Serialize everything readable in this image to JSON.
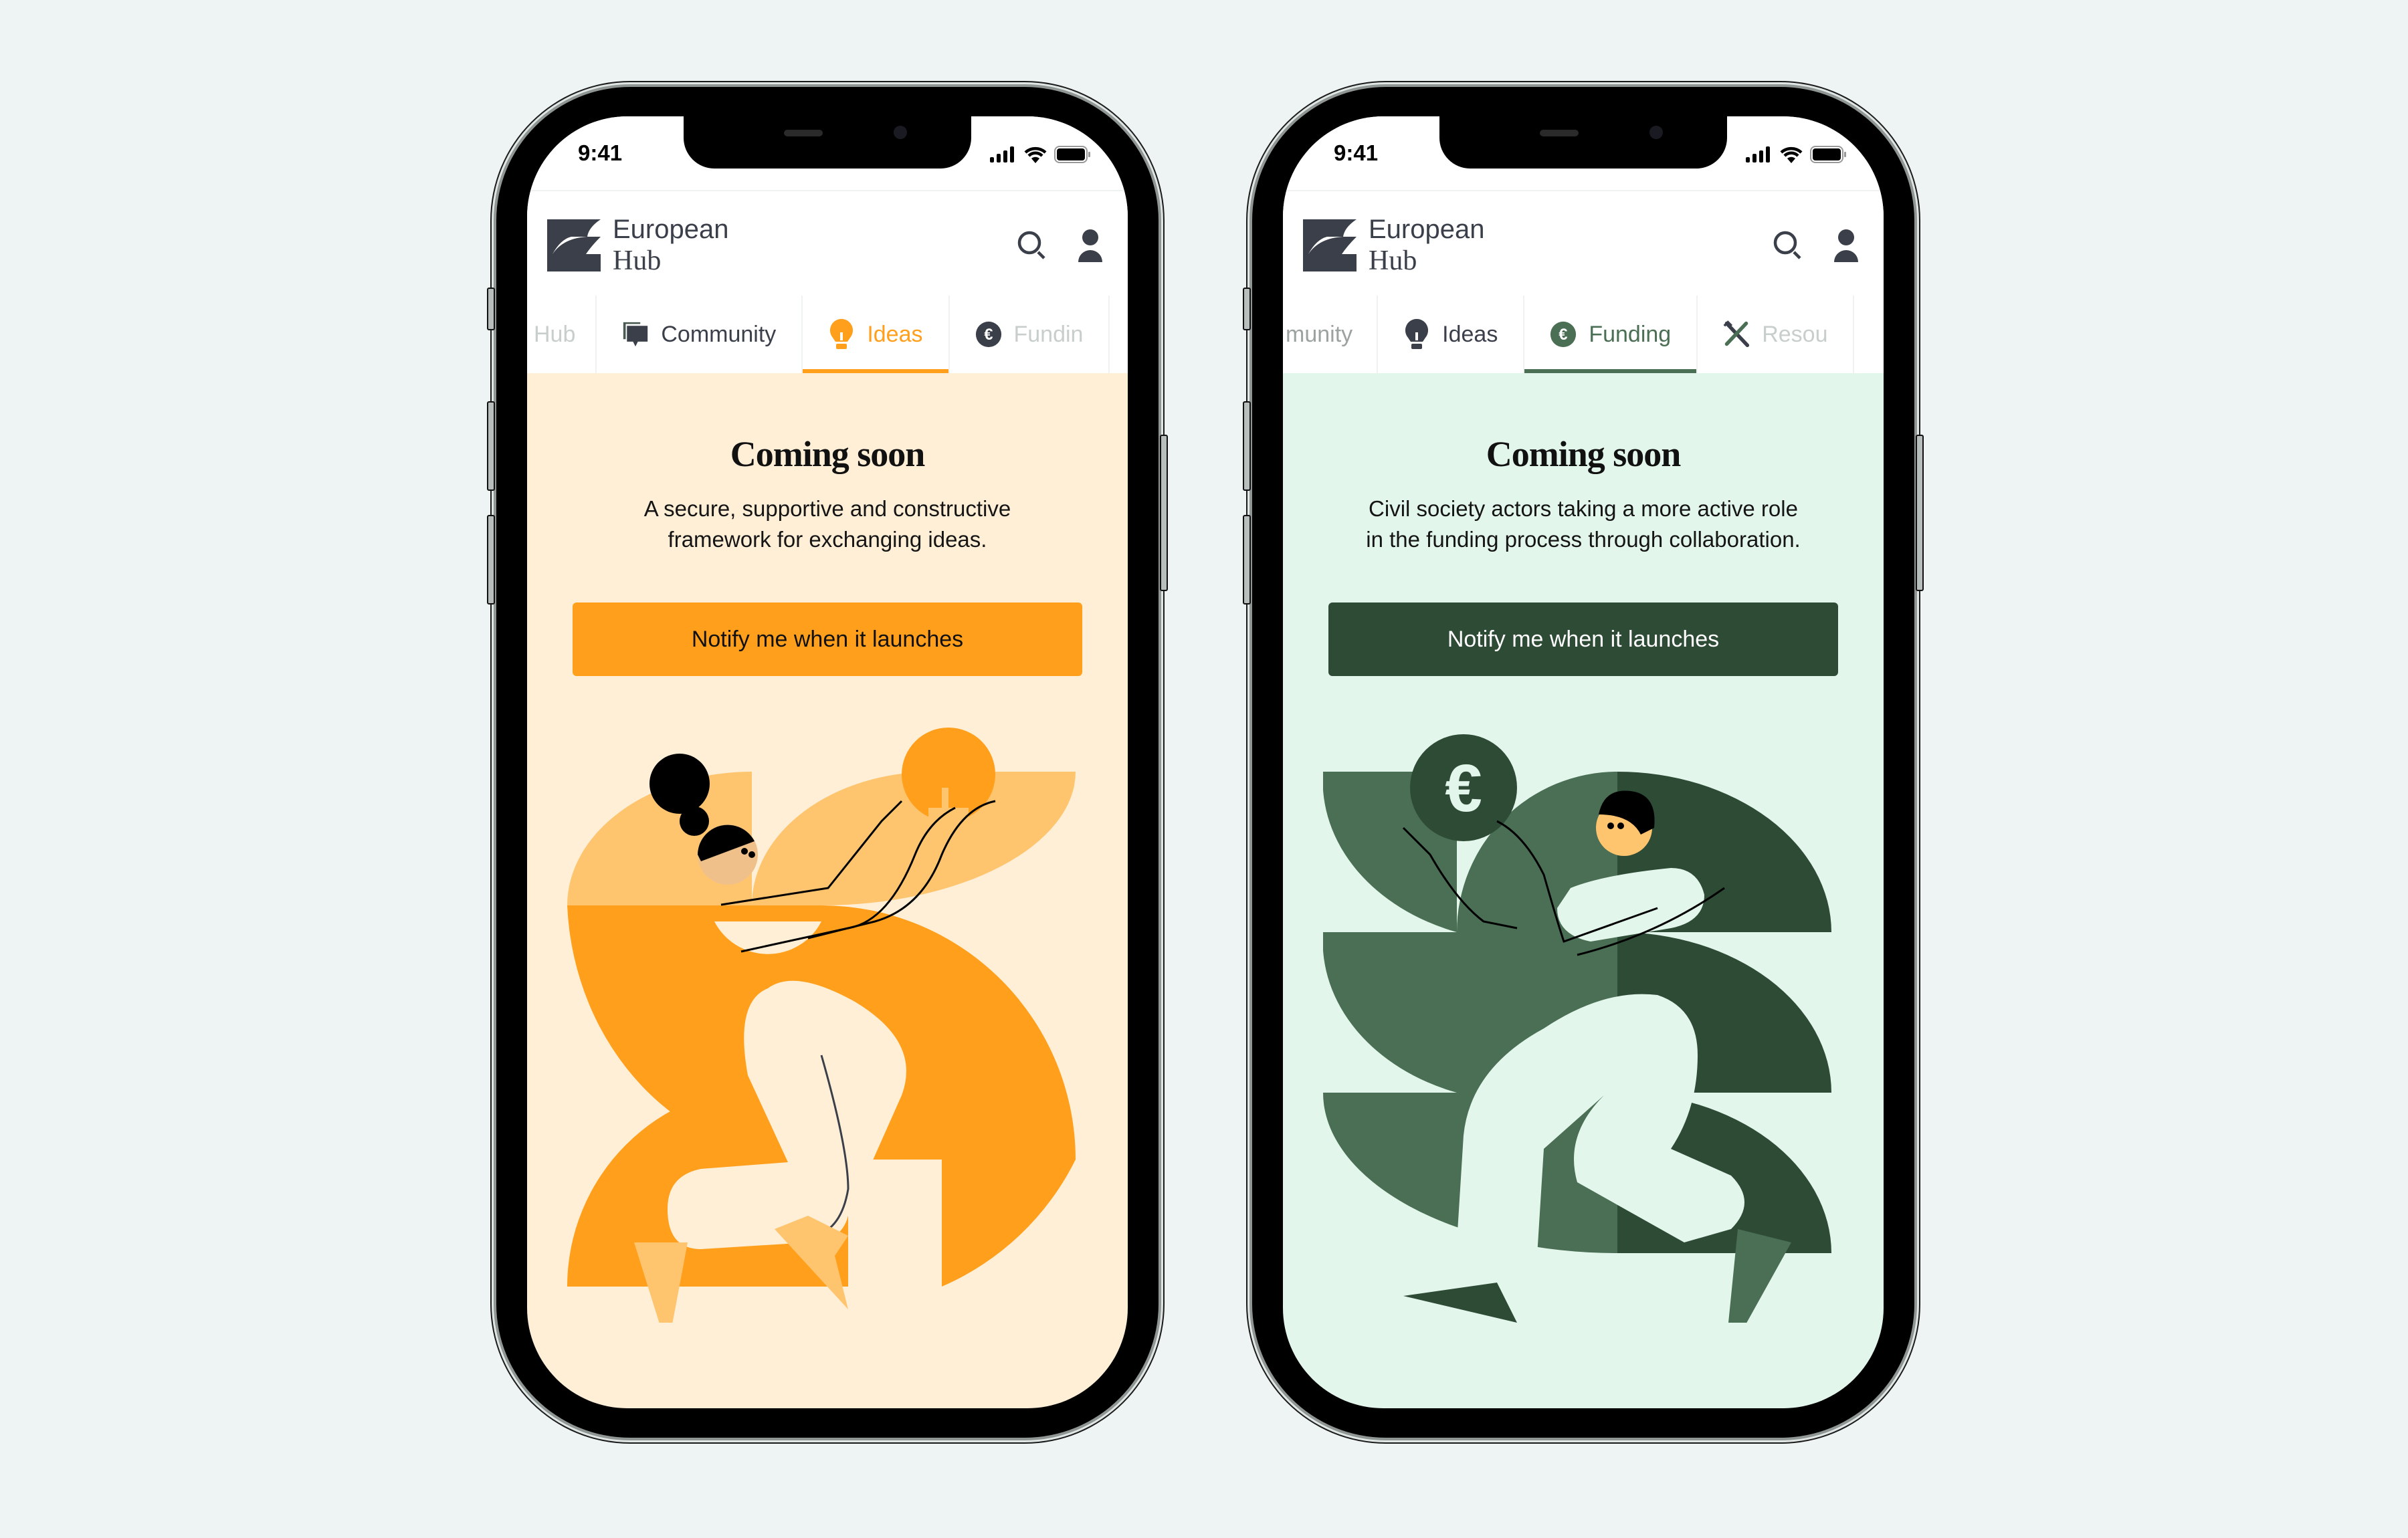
{
  "phones": [
    {
      "status": {
        "time": "9:41"
      },
      "brand": {
        "line1": "European",
        "line2": "Hub"
      },
      "tabs": [
        {
          "label": "Hub",
          "icon": "hub-icon",
          "state": "faded"
        },
        {
          "label": "Community",
          "icon": "chat-icon",
          "state": "normal"
        },
        {
          "label": "Ideas",
          "icon": "lightbulb-icon",
          "state": "active"
        },
        {
          "label": "Fundin",
          "icon": "euro-icon",
          "state": "faded"
        }
      ],
      "title": "Coming soon",
      "subtitle_line1": "A secure, supportive and constructive",
      "subtitle_line2": "framework for exchanging ideas.",
      "cta_label": "Notify me when it launches",
      "colors": {
        "accent": "#ff9f1c",
        "accent_light": "#ffc46e",
        "background": "#ffefd7",
        "button_text": "#111111"
      }
    },
    {
      "status": {
        "time": "9:41"
      },
      "brand": {
        "line1": "European",
        "line2": "Hub"
      },
      "tabs": [
        {
          "label": "munity",
          "icon": "",
          "state": "faded"
        },
        {
          "label": "Ideas",
          "icon": "lightbulb-icon",
          "state": "normal"
        },
        {
          "label": "Funding",
          "icon": "euro-icon",
          "state": "active"
        },
        {
          "label": "Resou",
          "icon": "tools-icon",
          "state": "faded"
        }
      ],
      "title": "Coming soon",
      "subtitle_line1": "Civil society actors taking a more active role",
      "subtitle_line2": "in the funding process through collaboration.",
      "cta_label": "Notify me when it launches",
      "colors": {
        "accent": "#4a6f54",
        "accent_dark": "#2e4b36",
        "background": "#e3f6ec",
        "button_bg": "#2e4b36",
        "button_text": "#ffffff"
      }
    }
  ]
}
